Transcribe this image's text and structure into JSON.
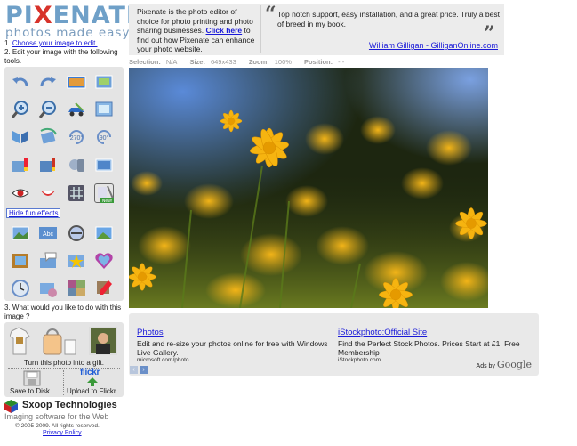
{
  "brand": {
    "logo_prefix": "PI",
    "logo_x": "X",
    "logo_suffix": "ENATE",
    "tagline": "photos made easy"
  },
  "steps": {
    "step1_prefix": "1.",
    "step1_link": "Choose your image to edit.",
    "step2": "2. Edit your image with the following tools."
  },
  "tools": [
    "rotate-left-icon",
    "rotate-right-icon",
    "resize-icon",
    "crop-icon",
    "zoom-in-icon",
    "zoom-out-icon",
    "red-eye-car-icon",
    "frame-icon",
    "flip-icon",
    "rotate-icon",
    "rotate-270-icon",
    "rotate-90-icon",
    "brightness-icon",
    "contrast-icon",
    "sharpen-icon",
    "levels-icon",
    "eye-icon",
    "smile-icon",
    "grid-icon",
    "new-tool-icon",
    "landscape-icon",
    "text-icon",
    "lens-icon",
    "film-icon",
    "picture-frame-icon",
    "speech-bubble-icon",
    "star-icon",
    "heart-icon",
    "clock-icon",
    "mail-icon",
    "collage-icon",
    "pencil-icon"
  ],
  "tool_labels": {
    "rotate_270": "270°",
    "rotate_90": "90°",
    "new_badge": "New!",
    "text_abc": "Abc"
  },
  "hide_fun_effects": "Hide fun effects",
  "question": "3. What would you like to do with this image ?",
  "save": {
    "gift": "Turn this photo into a gift.",
    "disk": "Save to Disk.",
    "flickr": "Upload to Flickr.",
    "flickr_logo": "flickr"
  },
  "company": {
    "name": "Sxoop Technologies",
    "tagline": "Imaging software for the Web",
    "copyright": "© 2005-2009. All rights reserved.",
    "privacy": "Privacy Policy"
  },
  "intro": {
    "text": "Pixenate is the photo editor of choice for photo printing and photo sharing businesses.",
    "link": "Click here",
    "text2": " to find out how Pixenate can enhance your photo website."
  },
  "testimonial": {
    "open_quote": "“",
    "text": "Top notch support, easy installation, and a great price. Truly a best of breed in my book.",
    "close_quote": "”",
    "author": "William Gilligan - GilliganOnline.com"
  },
  "status": {
    "selection_label": "Selection:",
    "selection_value": "N/A",
    "size_label": "Size:",
    "size_value": "649x433",
    "zoom_label": "Zoom:",
    "zoom_value": "100%",
    "position_label": "Position:",
    "position_value": "-,-"
  },
  "ads": [
    {
      "title": "Photos",
      "text": "Edit and re-size your photos online for free with Windows Live Gallery.",
      "url": "microsoft.com/photo"
    },
    {
      "title": "iStockphoto:Official Site",
      "text": "Find the Perfect Stock Photos. Prices Start at £1. Free Membership",
      "url": "iStockphoto.com"
    }
  ],
  "ads_by": {
    "prefix": "Ads by",
    "brand": "Google"
  }
}
